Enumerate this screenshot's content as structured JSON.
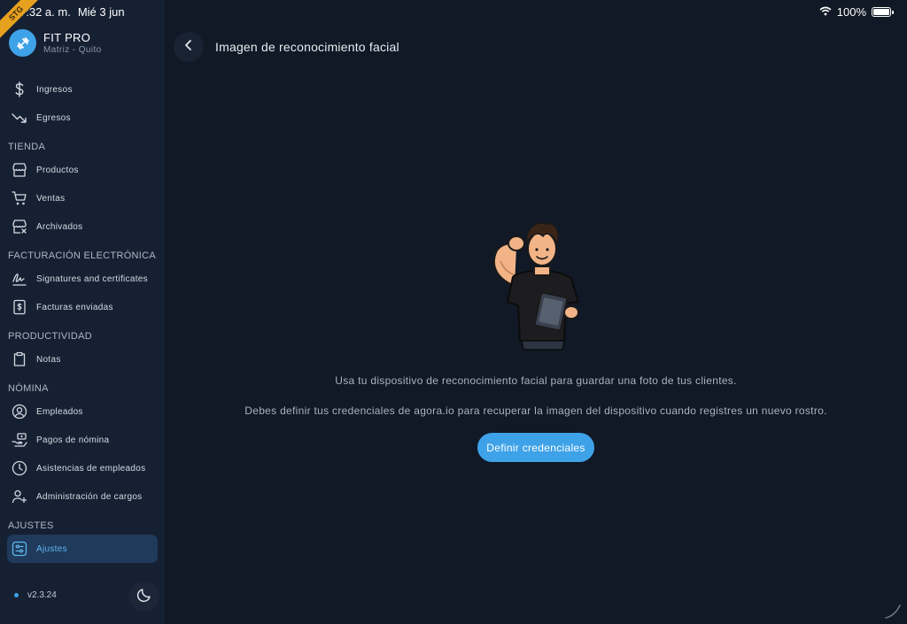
{
  "status_bar": {
    "time": "7:32 a. m.",
    "date": "Mié 3 jun",
    "battery": "100%",
    "battery_level": 1.0
  },
  "ribbon": {
    "label": "STG"
  },
  "brand": {
    "title": "FIT PRO",
    "subtitle": "Matriz - Quito",
    "logo_icon": "dumbbell-icon"
  },
  "sidebar": {
    "groups": [
      {
        "title": "",
        "items": [
          {
            "label": "Ingresos",
            "icon": "dollar-icon"
          },
          {
            "label": "Egresos",
            "icon": "trending-down-icon"
          }
        ]
      },
      {
        "title": "TIENDA",
        "items": [
          {
            "label": "Productos",
            "icon": "store-icon"
          },
          {
            "label": "Ventas",
            "icon": "cart-icon"
          },
          {
            "label": "Archivados",
            "icon": "archive-store-icon"
          }
        ]
      },
      {
        "title": "FACTURACIÓN ELECTRÓNICA",
        "items": [
          {
            "label": "Signatures and certificates",
            "icon": "signature-icon"
          },
          {
            "label": "Facturas enviadas",
            "icon": "invoice-icon"
          }
        ]
      },
      {
        "title": "PRODUCTIVIDAD",
        "items": [
          {
            "label": "Notas",
            "icon": "clipboard-icon"
          }
        ]
      },
      {
        "title": "NÓMINA",
        "items": [
          {
            "label": "Empleados",
            "icon": "user-circle-icon"
          },
          {
            "label": "Pagos de nómina",
            "icon": "payment-icon"
          },
          {
            "label": "Asistencias de empleados",
            "icon": "clock-icon"
          },
          {
            "label": "Administración de cargos",
            "icon": "user-add-icon"
          }
        ]
      },
      {
        "title": "AJUSTES",
        "items": [
          {
            "label": "Ajustes",
            "icon": "settings-sliders-icon",
            "active": true
          }
        ]
      }
    ],
    "version": "v2.3.24",
    "theme_icon": "moon-icon"
  },
  "main": {
    "title": "Imagen de reconocimiento facial",
    "back_icon": "chevron-left-icon",
    "illustration": "flexing-trainer-illustration",
    "message_1": "Usa tu dispositivo de reconocimiento facial para guardar una foto de tus clientes.",
    "message_2": "Debes definir tus credenciales de agora.io para recuperar la imagen del dispositivo cuando registres un nuevo rostro.",
    "cta_label": "Definir credenciales"
  },
  "colors": {
    "accent": "#3ea2e8",
    "sidebar_bg": "#162033",
    "main_bg": "#111826",
    "active_item_bg": "#1f3a5a",
    "ribbon": "#e6a11f"
  }
}
